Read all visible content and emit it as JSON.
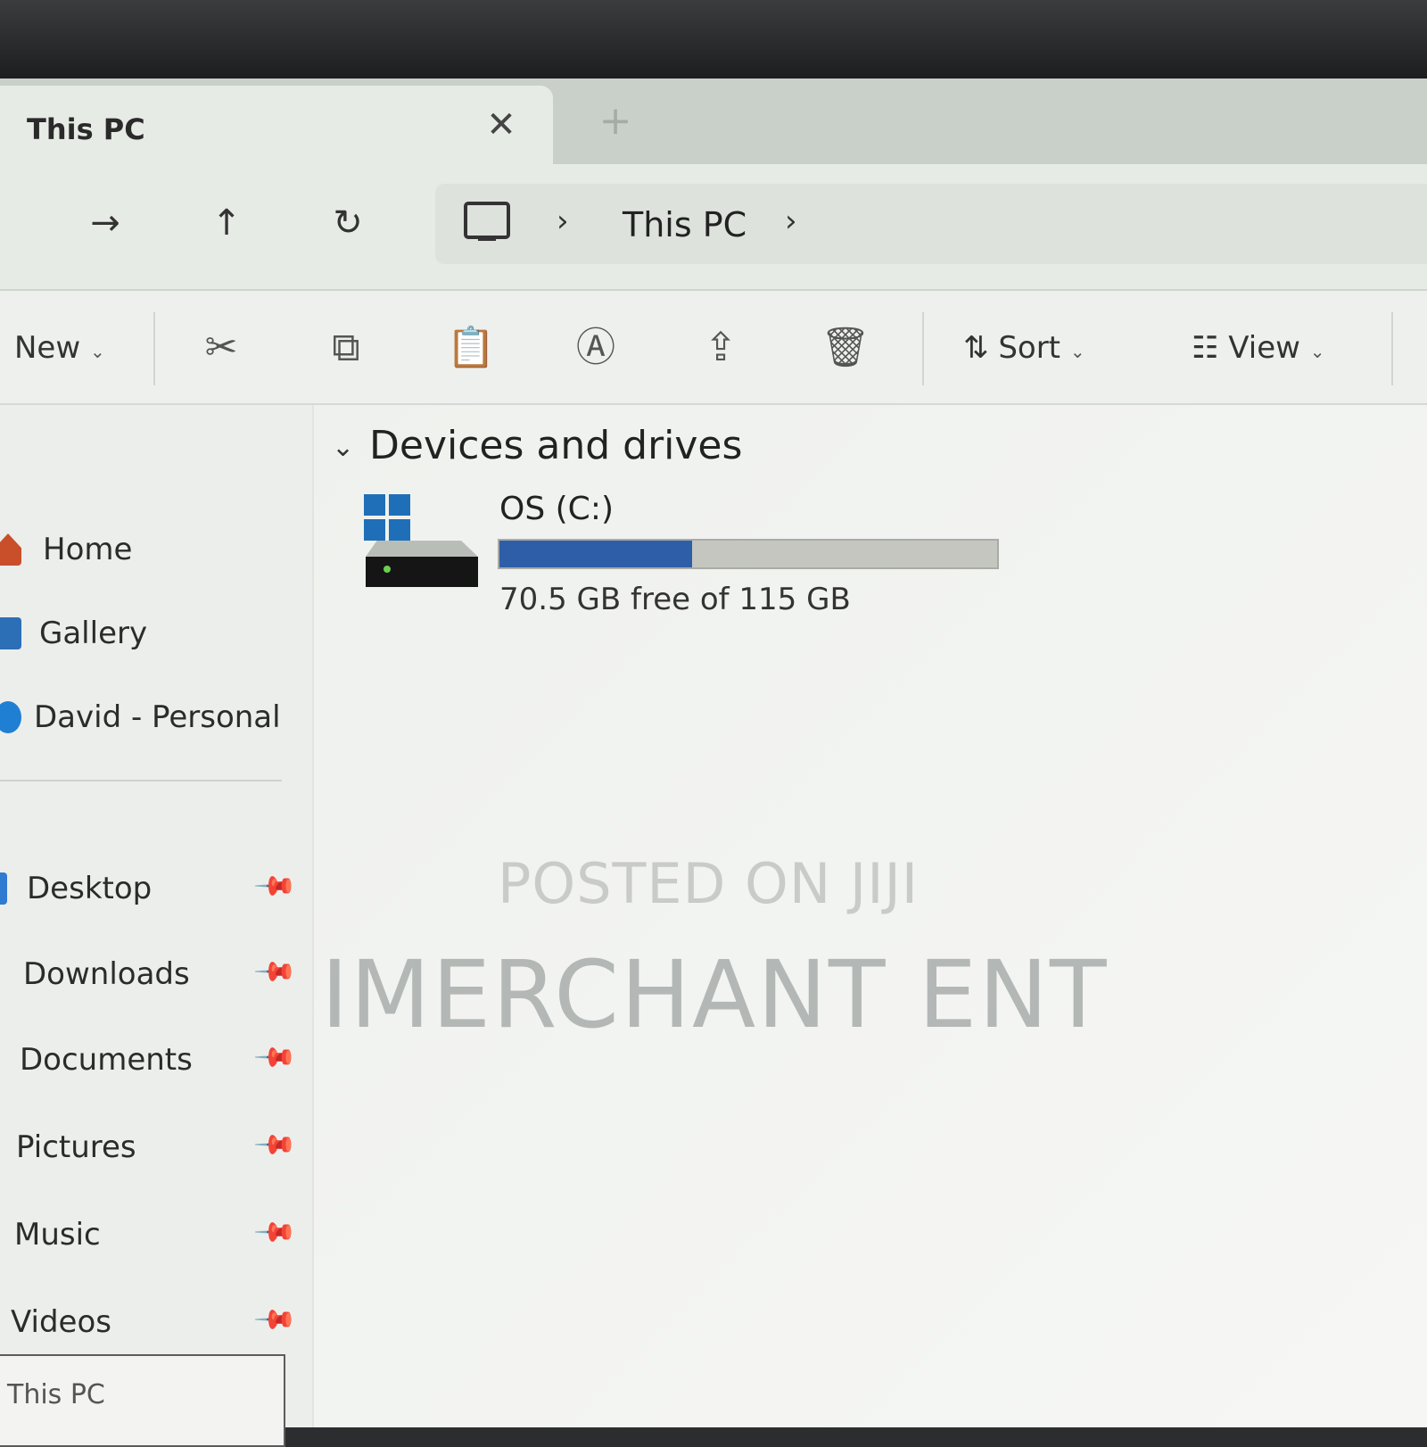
{
  "tab": {
    "title": "This PC",
    "close_icon": "close-icon",
    "new_tab_icon": "plus-icon"
  },
  "nav": {
    "forward": "→",
    "up": "↑",
    "refresh": "↻",
    "breadcrumb": {
      "location": "This PC",
      "separator": "›"
    }
  },
  "commands": {
    "new_label": "New",
    "sort_label": "Sort",
    "view_label": "View",
    "chevron": "⌄",
    "icons": [
      "scissors-icon",
      "copy-icon",
      "paste-icon",
      "rename-icon",
      "share-icon",
      "trash-icon"
    ]
  },
  "sidebar": {
    "top_items": [
      {
        "label": "Home",
        "icon": "home-icon",
        "color": "#c94f2a"
      },
      {
        "label": "Gallery",
        "icon": "gallery-icon",
        "color": "#2c6fb6"
      },
      {
        "label": "David - Personal",
        "icon": "onedrive-icon",
        "color": "#1f7fd3"
      }
    ],
    "pinned_items": [
      {
        "label": "Desktop",
        "icon": "desktop-folder-icon"
      },
      {
        "label": "Downloads",
        "icon": "downloads-folder-icon"
      },
      {
        "label": "Documents",
        "icon": "documents-folder-icon"
      },
      {
        "label": "Pictures",
        "icon": "pictures-folder-icon"
      },
      {
        "label": "Music",
        "icon": "music-folder-icon"
      },
      {
        "label": "Videos",
        "icon": "videos-folder-icon"
      }
    ],
    "bottom_label": "This PC"
  },
  "content": {
    "section_title": "Devices and drives",
    "drive": {
      "name": "OS (C:)",
      "free_text": "70.5 GB free of 115 GB",
      "used_fraction": 0.387,
      "bar_color": "#2f5ea8"
    }
  },
  "watermarks": {
    "line1": "POSTED ON JIJI",
    "line2": "IMERCHANT ENT"
  },
  "colors": {
    "accent": "#2f5ea8",
    "windows_blue": "#1f6fb8"
  }
}
